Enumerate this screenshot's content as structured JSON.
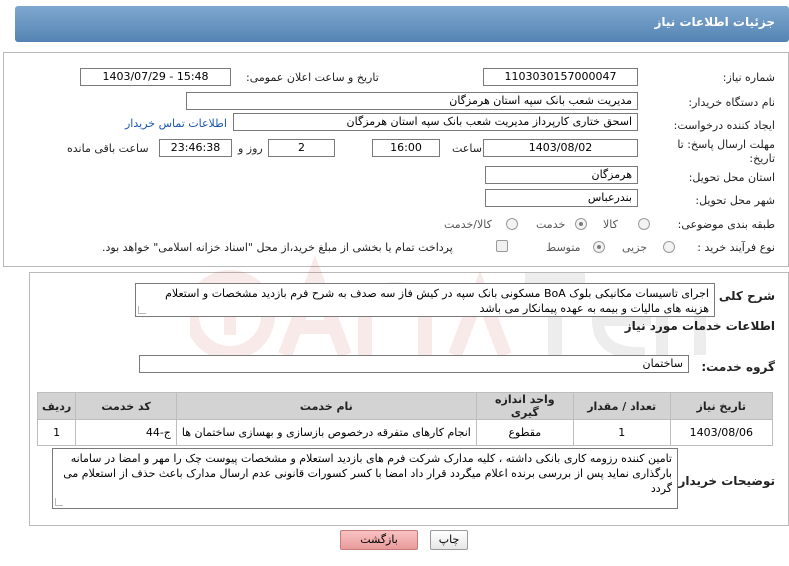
{
  "header": {
    "title": "جزئیات اطلاعات نیاز"
  },
  "fields": {
    "need_number_label": "شماره نیاز:",
    "need_number": "1103030157000047",
    "announce_label": "تاریخ و ساعت اعلان عمومی:",
    "announce_value": "1403/07/29 - 15:48",
    "buyer_org_label": "نام دستگاه خریدار:",
    "buyer_org": "مدیریت شعب بانک سپه استان هرمزگان",
    "requester_label": "ایجاد کننده درخواست:",
    "requester": "اسحق ختاری کارپرداز مدیریت شعب بانک سپه استان هرمزگان",
    "contact_link": "اطلاعات تماس خریدار",
    "deadline_label_1": "مهلت ارسال پاسخ: تا",
    "deadline_label_2": "تاریخ:",
    "deadline_date": "1403/08/02",
    "hour_label": "ساعت",
    "deadline_hour": "16:00",
    "days_value": "2",
    "days_label": "روز و",
    "remaining_time": "23:46:38",
    "remaining_label": "ساعت باقی مانده",
    "province_label": "استان محل تحویل:",
    "province": "هرمزگان",
    "city_label": "شهر محل تحویل:",
    "city": "بندرعباس",
    "category_label": "طبقه بندی موضوعی:",
    "category_options": [
      "کالا",
      "خدمت",
      "کالا/خدمت"
    ],
    "process_label": "نوع فرآیند خرید :",
    "process_options": [
      "جزیی",
      "متوسط"
    ],
    "payment_note": "پرداخت تمام یا بخشی از مبلغ خرید،از محل \"اسناد خزانه اسلامی\" خواهد بود."
  },
  "general": {
    "label": "شرح کلی نیاز:",
    "text": "اجرای تاسیسات مکانیکی بلوک BoA مسکونی بانک سپه در کیش فاز سه صدف به شرح فرم بازدید مشخصات و استعلام هزینه های مالیات و بیمه به عهده پیمانکار می باشد"
  },
  "services": {
    "section_title": "اطلاعات خدمات مورد نیاز",
    "group_label": "گروه خدمت:",
    "group_value": "ساختمان",
    "columns": [
      "ردیف",
      "کد خدمت",
      "نام خدمت",
      "واحد اندازه گیری",
      "تعداد / مقدار",
      "تاریخ نیاز"
    ],
    "rows": [
      [
        "1",
        "ج-44",
        "انجام کارهای متفرقه درخصوص بازسازی و بهسازی ساختمان ها",
        "مقطوع",
        "1",
        "1403/08/06"
      ]
    ]
  },
  "buyer_notes": {
    "label": "توضیحات خریدار:",
    "text": "تامین کننده رزومه کاری بانکی داشته ، کلیه مدارک شرکت فرم های بازدید استعلام  و مشخصات پیوست  چک را مهر و امضا در سامانه بارگذاری نماید پس از بررسی برنده اعلام میگردد  قرار داد امضا با کسر کسورات قانونی عدم ارسال مدارک باعث حذف از استعلام می گردد"
  },
  "buttons": {
    "print": "چاپ",
    "back": "بازگشت"
  },
  "colors": {
    "header": "#6a97c3",
    "link": "#1a56b0",
    "back_button": "#f0a8a8",
    "table_header": "#d3d3d3"
  }
}
